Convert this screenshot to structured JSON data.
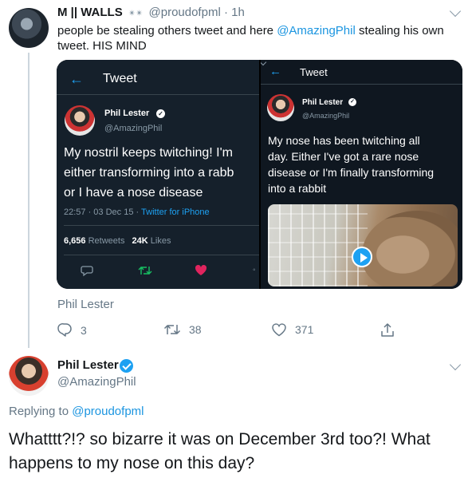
{
  "tweet": {
    "display_name": "M || WALLS",
    "name_symbol": "✴✴",
    "handle": "@proudofpml",
    "dot": "·",
    "time": "1h",
    "text_before": "people be stealing others tweet and here ",
    "mention": "@AmazingPhil",
    "text_after": " stealing his own tweet. HIS MIND",
    "quote_author": "Phil Lester",
    "actions": {
      "reply_count": "3",
      "retweet_count": "38",
      "like_count": "371"
    }
  },
  "media": {
    "left": {
      "header": "Tweet",
      "name": "Phil Lester",
      "handle": "@AmazingPhil",
      "text_lines": [
        "My nostril keeps twitching! I'm",
        "either  transforming into a rabb",
        "or I have a nose disease"
      ],
      "meta_time": "22:57 · 03 Dec 15 · ",
      "meta_source": "Twitter for iPhone",
      "retweets": "6,656",
      "retweets_label": "Retweets",
      "likes": "24K",
      "likes_label": "Likes"
    },
    "right": {
      "header": "Tweet",
      "name": "Phil Lester",
      "handle": "@AmazingPhil",
      "text_lines": [
        "My nose has been twitching all",
        "day. Either I've got a rare nose",
        "disease or I'm finally transforming",
        "into a rabbit"
      ]
    }
  },
  "reply": {
    "display_name": "Phil Lester",
    "handle": "@AmazingPhil",
    "replying_to_label": "Replying to ",
    "replying_to_handle": "@proudofpml",
    "text": "Whatttt?!? so bizarre it was on December 3rd too?! What happens to my nose on this day?"
  },
  "colors": {
    "accent": "#1da1f2",
    "like": "#e0245e",
    "retweet_green": "#17bf63"
  }
}
